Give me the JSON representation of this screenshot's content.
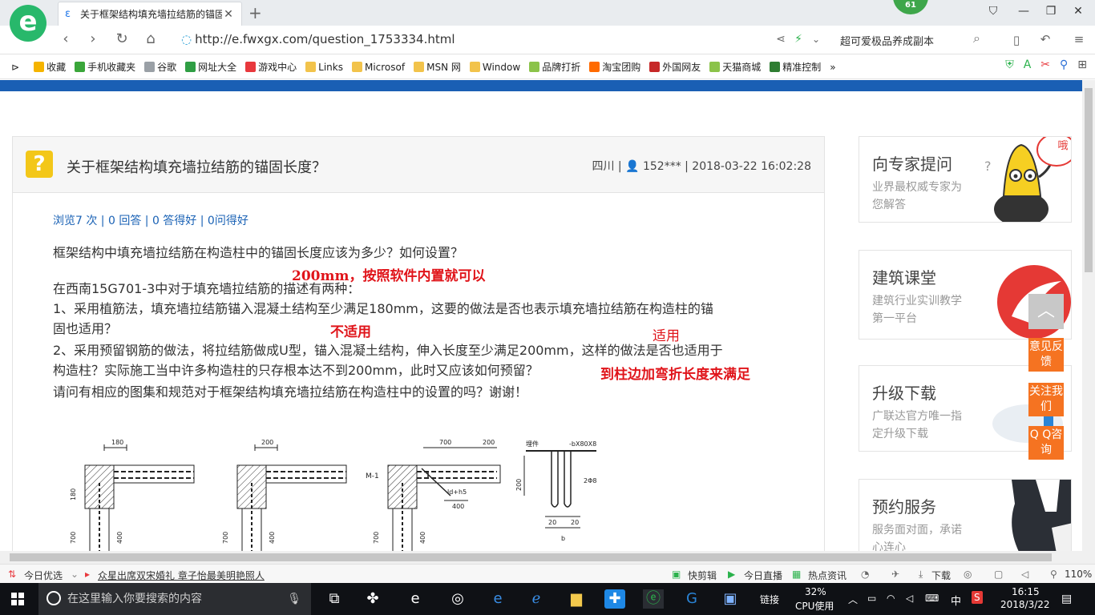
{
  "browser": {
    "tab_title": "关于框架结构填充墙拉结筋的锚固",
    "url": "http://e.fwxgx.com/question_1753334.html",
    "badge_count": "61",
    "search_text": "超可爱极品养成副本",
    "logo_letter": "e"
  },
  "bookmarks": [
    {
      "label": "收藏",
      "color": "#f5b400"
    },
    {
      "label": "手机收藏夹",
      "color": "#3aa63a"
    },
    {
      "label": "谷歌",
      "color": "#9aa0a6"
    },
    {
      "label": "网址大全",
      "color": "#2f9e44"
    },
    {
      "label": "游戏中心",
      "color": "#e8383d"
    },
    {
      "label": "Links",
      "color": "#f2c34b"
    },
    {
      "label": "Microsof",
      "color": "#f2c34b"
    },
    {
      "label": "MSN 网",
      "color": "#f2c34b"
    },
    {
      "label": "Window",
      "color": "#f2c34b"
    },
    {
      "label": "品牌打折",
      "color": "#8bc34a"
    },
    {
      "label": "淘宝团购",
      "color": "#ff6a00"
    },
    {
      "label": "外国网友",
      "color": "#c62828"
    },
    {
      "label": "天猫商城",
      "color": "#8bc34a"
    },
    {
      "label": "精准控制",
      "color": "#2e7d32"
    }
  ],
  "question": {
    "title": "关于框架结构填充墙拉结筋的锚固长度？",
    "meta": "四川 | 👤 152*** | 2018-03-22 16:02:28",
    "stats": "浏览7 次 | 0 回答 | 0 答得好 | 0问得好",
    "line1": "框架结构中填充墙拉结筋在构造柱中的锚固长度应该为多少？如何设置？",
    "line2": "在西南15G701-3中对于填充墙拉结筋的描述有两种：",
    "line3": "1、采用植筋法，填充墙拉结筋锚入混凝土结构至少满足180mm，这要的做法是否也表示填充墙拉结筋在构造柱的锚",
    "line4": "固也适用？",
    "line5": "2、采用预留钢筋的做法，将拉结筋做成U型，锚入混凝土结构，伸入长度至少满足200mm，这样的做法是否也适用于",
    "line6": "构造柱？实际施工当中许多构造柱的只存根本达不到200mm，此时又应该如何预留？",
    "line7": "请问有相应的图集和规范对于框架结构填充墙拉结筋在构造柱中的设置的吗？谢谢！"
  },
  "annotations": {
    "a1": "200mm，按照软件内置就可以",
    "a2": "不适用",
    "a3": "适用",
    "a4": "到柱边加弯折长度来满足"
  },
  "drawing_labels": {
    "d1": "180",
    "d2": "200",
    "d3": "700",
    "d4": "200",
    "m1": "M-1",
    "lb": "ld+h5",
    "w400": "400",
    "embed": "埋件",
    "plate": "-bX80X8",
    "bar": "2Φ8",
    "v180": "180",
    "v700a": "700",
    "v400a": "400",
    "v700b": "700",
    "v400b": "400",
    "v700c": "700",
    "v400c": "400",
    "n20a": "20",
    "n20b": "20",
    "n200": "200",
    "b": "b"
  },
  "sidebar": [
    {
      "title": "向专家提问",
      "sub": "业界最权威专家为您解答",
      "tag": "点我提问哦"
    },
    {
      "title": "建筑课堂",
      "sub": "建筑行业实训教学第一平台"
    },
    {
      "title": "升级下载",
      "sub": "广联达官方唯一指定升级下载"
    },
    {
      "title": "预约服务",
      "sub": "服务面对面，承诺心连心"
    }
  ],
  "float_buttons": {
    "feedback": "意见反馈",
    "follow": "关注我们",
    "qq": "Q Q咨询",
    "top_icon": "chevron-up-icon"
  },
  "status_bar": {
    "today": "今日优选",
    "news": "众星出席双宋婚礼 章子怡最美明艳照人",
    "kuaijianji": "快剪辑",
    "live": "今日直播",
    "hot": "热点资讯",
    "download": "下载",
    "zoom": "110%"
  },
  "taskbar": {
    "search_placeholder": "在这里输入你要搜索的内容",
    "link": "链接",
    "cpu": "32%",
    "cpu_label": "CPU使用",
    "ime": "中",
    "time": "16:15",
    "date": "2018/3/22"
  }
}
